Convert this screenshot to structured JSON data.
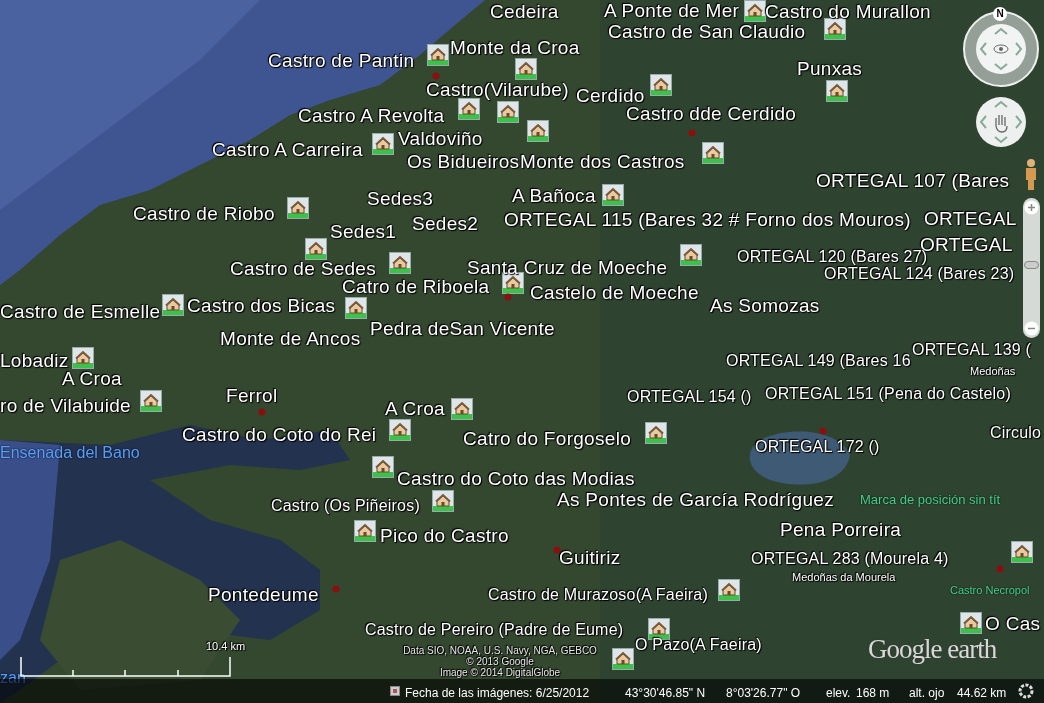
{
  "labels": [
    {
      "text": "Cedeira",
      "kind": "place"
    },
    {
      "text": "A Ponte de Mer",
      "kind": "place"
    },
    {
      "text": "Castro do Murallon",
      "kind": "place"
    },
    {
      "text": "Castro de San Claudio",
      "kind": "place"
    },
    {
      "text": "Monte da Croa",
      "kind": "place"
    },
    {
      "text": "Castro de Pantin",
      "kind": "place"
    },
    {
      "text": "Punxas",
      "kind": "place"
    },
    {
      "text": "Castro(Vilarube)",
      "kind": "place"
    },
    {
      "text": "Cerdido",
      "kind": "place"
    },
    {
      "text": "Castro A Revolta",
      "kind": "place"
    },
    {
      "text": "Castro dde Cerdido",
      "kind": "place"
    },
    {
      "text": "Valdoviño",
      "kind": "place"
    },
    {
      "text": "Castro A Carreira",
      "kind": "place"
    },
    {
      "text": "Os Bidueiros",
      "kind": "place"
    },
    {
      "text": "Monte dos Castros",
      "kind": "place"
    },
    {
      "text": "ORTEGAL 107 (Bares",
      "kind": "place"
    },
    {
      "text": "Sedes3",
      "kind": "place"
    },
    {
      "text": "A Bañoca",
      "kind": "place"
    },
    {
      "text": "Castro de Riobo",
      "kind": "place"
    },
    {
      "text": "Sedes2",
      "kind": "place"
    },
    {
      "text": "ORTEGAL 115 (Bares 32 # Forno dos Mouros)",
      "kind": "place"
    },
    {
      "text": "ORTEGAL",
      "kind": "place"
    },
    {
      "text": "Sedes1",
      "kind": "place"
    },
    {
      "text": "ORTEGAL",
      "kind": "place"
    },
    {
      "text": "ORTEGAL 120 (Bares 27)",
      "kind": "site"
    },
    {
      "text": "Castro de Sedes",
      "kind": "place"
    },
    {
      "text": "Santa Cruz de Moeche",
      "kind": "place"
    },
    {
      "text": "ORTEGAL 124 (Bares 23)",
      "kind": "site"
    },
    {
      "text": "Catro de Riboela",
      "kind": "place"
    },
    {
      "text": "Castelo de Moeche",
      "kind": "place"
    },
    {
      "text": "Castro dos Bicas",
      "kind": "place"
    },
    {
      "text": "As Somozas",
      "kind": "place"
    },
    {
      "text": "Castro de Esmelle",
      "kind": "place"
    },
    {
      "text": "Pedra deSan Vicente",
      "kind": "place"
    },
    {
      "text": "Monte de Ancos",
      "kind": "place"
    },
    {
      "text": "ORTEGAL 139 (",
      "kind": "site"
    },
    {
      "text": "Lobadiz",
      "kind": "place"
    },
    {
      "text": "ORTEGAL 149 (Bares 16",
      "kind": "site"
    },
    {
      "text": "A Croa",
      "kind": "place"
    },
    {
      "text": "Medoñas",
      "kind": "village"
    },
    {
      "text": "ro de Vilabuide",
      "kind": "place"
    },
    {
      "text": "Ferrol",
      "kind": "place"
    },
    {
      "text": "A Croa",
      "kind": "place"
    },
    {
      "text": "ORTEGAL 154 ()",
      "kind": "site"
    },
    {
      "text": "ORTEGAL 151 (Pena do Castelo)",
      "kind": "site"
    },
    {
      "text": "Castro do Coto do Rei",
      "kind": "place"
    },
    {
      "text": "Catro do Forgoselo",
      "kind": "place"
    },
    {
      "text": "Circulo",
      "kind": "site"
    },
    {
      "text": "Ensenada del Bano",
      "kind": "water"
    },
    {
      "text": "ORTEGAL 172 ()",
      "kind": "site"
    },
    {
      "text": "Castro do Coto das Modias",
      "kind": "place"
    },
    {
      "text": "Castro (Os Piñeiros)",
      "kind": "site"
    },
    {
      "text": "As Pontes de García Rodríguez",
      "kind": "place"
    },
    {
      "text": "Marca de posición sin tít",
      "kind": "marker"
    },
    {
      "text": "Pico do Castro",
      "kind": "place"
    },
    {
      "text": "Pena Porreira",
      "kind": "place"
    },
    {
      "text": "Guitiriz",
      "kind": "place"
    },
    {
      "text": "ORTEGAL 283 (Mourela 4)",
      "kind": "site"
    },
    {
      "text": "Medoñas da Mourela",
      "kind": "village"
    },
    {
      "text": "Pontedeume",
      "kind": "place"
    },
    {
      "text": "Castro de Murazoso(A Faeira)",
      "kind": "site"
    },
    {
      "text": "Castro Necropol",
      "kind": "marker_small"
    },
    {
      "text": "O Cas",
      "kind": "place"
    },
    {
      "text": "Castro de Pereiro (Padre de Eume)",
      "kind": "site"
    },
    {
      "text": "O Pazo(A Faeira)",
      "kind": "site"
    },
    {
      "text": "zan",
      "kind": "water"
    }
  ],
  "attribution": [
    "Data SIO, NOAA, U.S. Navy, NGA, GEBCO",
    "© 2013 Google",
    "Image © 2014 DigitalGlobe"
  ],
  "logo": "Google earth",
  "scale_bar": "10.4 km",
  "compass": "N",
  "zoom_slider": {
    "level": 0.54
  },
  "status_bar": {
    "imagery_date": "Fecha de las imágenes: 6/25/2012",
    "latitude": "43°30'46.85\" N",
    "longitude": "8°03'26.77\" O",
    "elevation_label": "elev.",
    "elevation": "168 m",
    "eye_altitude_label": "alt. ojo",
    "eye_altitude": "44.62 km"
  }
}
